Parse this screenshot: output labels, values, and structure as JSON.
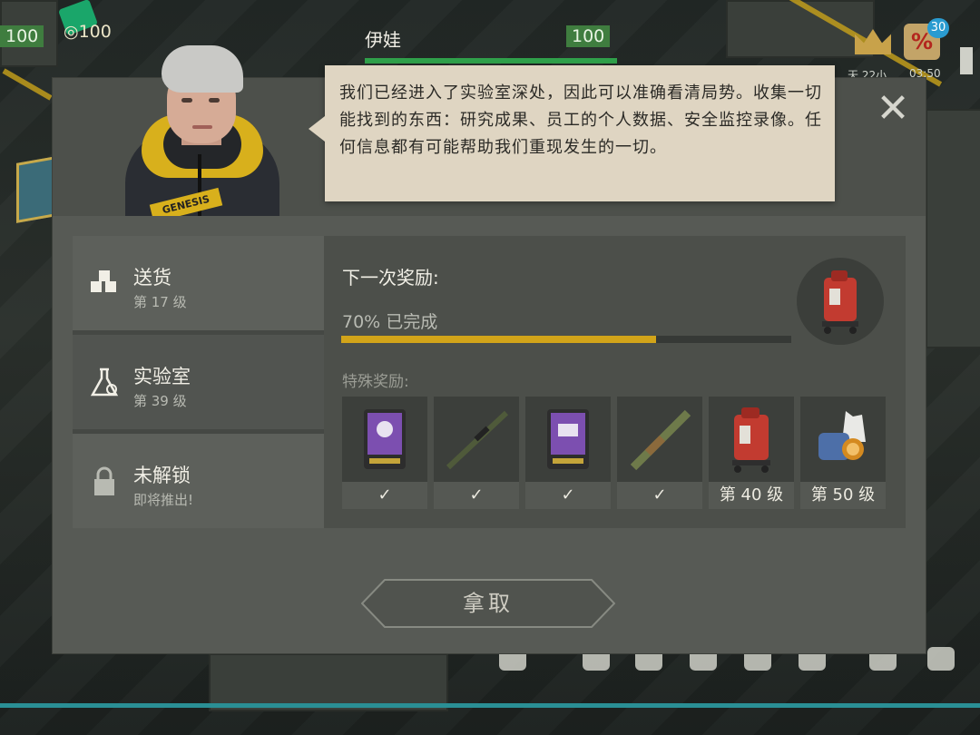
{
  "hud": {
    "left_value": "100",
    "coin_value": "100",
    "player_name": "伊娃",
    "player_value": "100",
    "badge_count": "30",
    "badge_symbol": "%",
    "timer": "03:50",
    "partial_text": "天 22小"
  },
  "dialog": {
    "close_symbol": "✕",
    "speech": "我们已经进入了实验室深处，因此可以准确看清局势。收集一切能找到的东西：研究成果、员工的个人数据、安全监控录像。任何信息都有可能帮助我们重现发生的一切。",
    "portrait_logo": "GENESIS",
    "sidebar": {
      "items": [
        {
          "label": "送货",
          "sub": "第 17 级",
          "icon": "boxes-icon"
        },
        {
          "label": "实验室",
          "sub": "第 39 级",
          "icon": "flask-icon"
        },
        {
          "label": "未解锁",
          "sub": "即将推出!",
          "icon": "lock-icon"
        }
      ]
    },
    "main": {
      "next_reward_title": "下一次奖励:",
      "progress_text": "70% 已完成",
      "progress_value": 0.7,
      "special_title": "特殊奖励:",
      "rewards": [
        {
          "name": "skull-card-icon",
          "status": "✓"
        },
        {
          "name": "sniper-rifle-icon",
          "status": "✓"
        },
        {
          "name": "item-card-icon",
          "status": "✓"
        },
        {
          "name": "camo-rifle-icon",
          "status": "✓"
        },
        {
          "name": "red-backpack-icon",
          "status": "第 40 级"
        },
        {
          "name": "clothing-bundle-icon",
          "status": "第 50 级"
        }
      ]
    },
    "get_button": "拿取"
  },
  "colors": {
    "accent_yellow": "#d2a419",
    "check_green": "#3cc25a",
    "speech_bg": "#dfd5c2",
    "hud_green": "#3f7d3f"
  }
}
